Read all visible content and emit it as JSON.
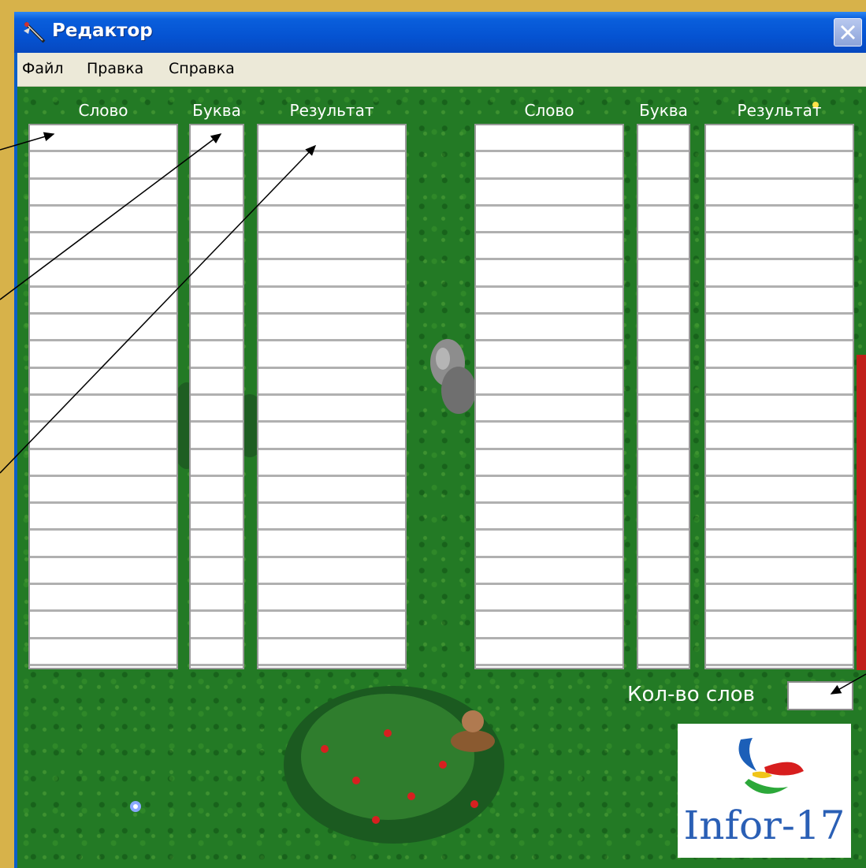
{
  "window": {
    "title": "Редактор",
    "icon": "editor-app-icon",
    "close_icon": "close-icon"
  },
  "menu": {
    "file": "Файл",
    "edit": "Правка",
    "help": "Справка"
  },
  "left_group": {
    "word_header": "Слово",
    "letter_header": "Буква",
    "result_header": "Результат"
  },
  "right_group": {
    "word_header": "Слово",
    "letter_header": "Буква",
    "result_header": "Результат"
  },
  "rows_per_list": 20,
  "word_count": {
    "label": "Кол-во слов",
    "value": ""
  },
  "logo": {
    "text": "Infor-17"
  },
  "colors": {
    "title_bar": "#0553d2",
    "menu_bar": "#ece9d8",
    "background_grass": "#237a25",
    "page_border": "#d7b24a"
  }
}
